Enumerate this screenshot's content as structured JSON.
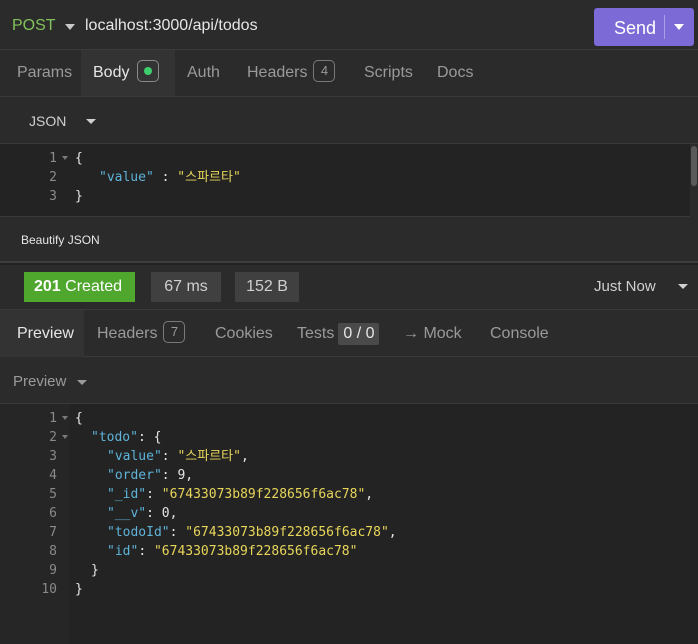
{
  "request": {
    "method": "POST",
    "url": "localhost:3000/api/todos",
    "send_label": "Send",
    "tabs": [
      {
        "label": "Params"
      },
      {
        "label": "Body"
      },
      {
        "label": "Auth"
      },
      {
        "label": "Headers",
        "badge": "4"
      },
      {
        "label": "Scripts"
      },
      {
        "label": "Docs"
      }
    ],
    "body_format": "JSON",
    "beautify_label": "Beautify JSON",
    "body_lines": [
      "1",
      "2",
      "3"
    ],
    "body": {
      "open": "{",
      "key": "\"value\"",
      "sep": " : ",
      "val": "\"스파르타\"",
      "close": "}"
    }
  },
  "response": {
    "status_code": "201",
    "status_text": "Created",
    "time": "67 ms",
    "size": "152 B",
    "history": "Just Now",
    "tabs": [
      {
        "label": "Preview"
      },
      {
        "label": "Headers",
        "badge": "7"
      },
      {
        "label": "Cookies"
      },
      {
        "label": "Tests",
        "badge": "0 / 0"
      },
      {
        "label": "→ Mock"
      },
      {
        "label": "Console"
      }
    ],
    "preview_mode": "Preview",
    "line_numbers": [
      "1",
      "2",
      "3",
      "4",
      "5",
      "6",
      "7",
      "8",
      "9",
      "10"
    ],
    "json": {
      "open": "{",
      "todo_key": "\"todo\"",
      "todo_open": ": {",
      "value_key": "\"value\"",
      "value_val": "\"스파르타\"",
      "order_key": "\"order\"",
      "order_val": "9",
      "id_key": "\"_id\"",
      "id_val": "\"67433073b89f228656f6ac78\"",
      "v_key": "\"__v\"",
      "v_val": "0",
      "todoid_key": "\"todoId\"",
      "todoid_val": "\"67433073b89f228656f6ac78\"",
      "id2_key": "\"id\"",
      "id2_val": "\"67433073b89f228656f6ac78\"",
      "inner_close": "}",
      "close": "}"
    }
  },
  "colors": {
    "accent": "#7c6bd6",
    "success": "#4fa72e",
    "method": "#82c25a",
    "key": "#5fb3d9",
    "string": "#e8d65a"
  }
}
